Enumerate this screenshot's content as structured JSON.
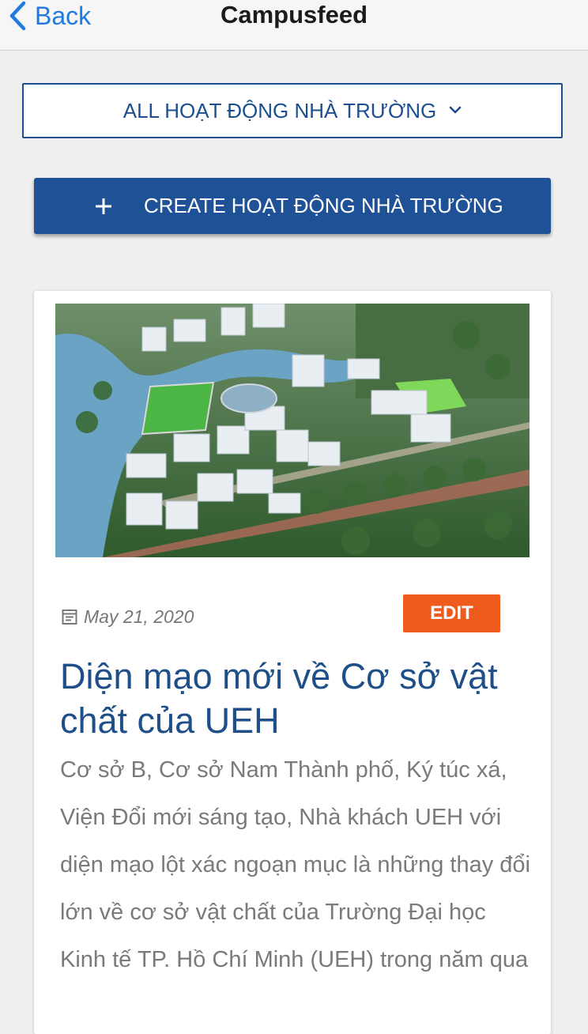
{
  "nav": {
    "back_label": "Back",
    "title": "Campusfeed"
  },
  "filter": {
    "selected": "ALL HOẠT ĐỘNG NHÀ TRƯỜNG",
    "icon": "chevron-down-icon"
  },
  "create_button": {
    "label": "CREATE HOẠT ĐỘNG NHÀ TRƯỜNG",
    "icon": "plus-icon"
  },
  "colors": {
    "accent": "#1f5196",
    "link_blue": "#1f7ae0",
    "edit_orange": "#ee5b1d",
    "title_blue": "#1e4f88"
  },
  "post": {
    "image": "campus-aerial-rendering",
    "date": "May 21, 2020",
    "edit_label": "EDIT",
    "title": "Diện mạo mới về Cơ sở vật chất của UEH",
    "excerpt": "Cơ sở B, Cơ sở Nam Thành phố, Ký túc xá, Viện Đổi mới sáng tạo, Nhà khách UEH với diện mạo lột xác ngoạn mục là những thay đổi lớn về cơ sở vật chất của Trường Đại học Kinh tế TP. Hồ Chí Minh (UEH) trong năm qua"
  }
}
